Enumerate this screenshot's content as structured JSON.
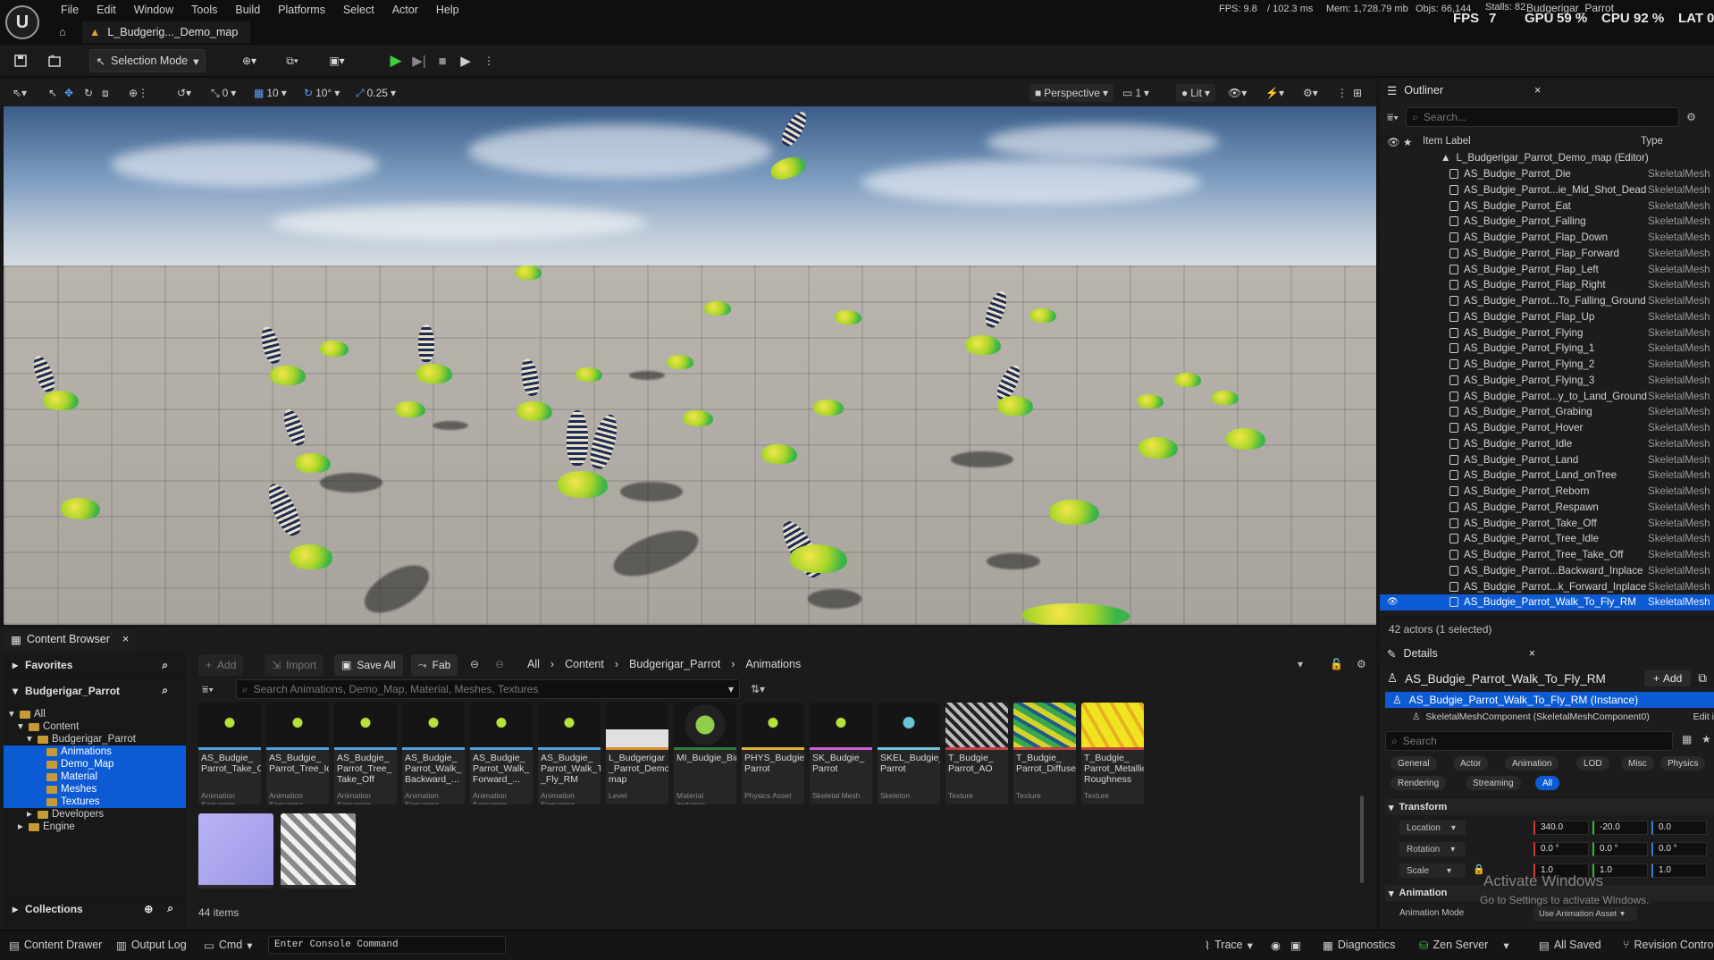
{
  "menu": [
    "File",
    "Edit",
    "Window",
    "Tools",
    "Build",
    "Platforms",
    "Select",
    "Actor",
    "Help"
  ],
  "doc_tab": "L_Budgerig..._Demo_map",
  "stats": {
    "fps_line": "FPS: 9.8",
    "ms": "/ 102.3 ms",
    "mem": "Mem: 1,728.79 mb",
    "objs": "Objs: 66,144",
    "stalls": "Stalls: 82",
    "project": "Budgerigar_Parrot",
    "fps_label": "FPS",
    "fps_value": "7",
    "gpu_label": "GPU",
    "gpu_value": "59 %",
    "cpu_label": "CPU",
    "cpu_value": "92 %",
    "lat_label": "LAT",
    "lat_value": "0"
  },
  "toolbar": {
    "selection_mode": "Selection Mode"
  },
  "viewport_toolbar": {
    "snap_angle": "0",
    "grid_size": "10",
    "rot_snap": "10°",
    "scale_snap": "0.25",
    "view_mode": "Perspective",
    "camera_speed": "1",
    "lighting": "Lit"
  },
  "outliner": {
    "title": "Outliner",
    "search_placeholder": "Search...",
    "col_label": "Item Label",
    "col_type": "Type",
    "root": "L_Budgerigar_Parrot_Demo_map (Editor)",
    "items": [
      {
        "label": "AS_Budgie_Parrot_Die",
        "type": "SkeletalMesh"
      },
      {
        "label": "AS_Budgie_Parrot...ie_Mid_Shot_Dead",
        "type": "SkeletalMesh"
      },
      {
        "label": "AS_Budgie_Parrot_Eat",
        "type": "SkeletalMesh"
      },
      {
        "label": "AS_Budgie_Parrot_Falling",
        "type": "SkeletalMesh"
      },
      {
        "label": "AS_Budgie_Parrot_Flap_Down",
        "type": "SkeletalMesh"
      },
      {
        "label": "AS_Budgie_Parrot_Flap_Forward",
        "type": "SkeletalMesh"
      },
      {
        "label": "AS_Budgie_Parrot_Flap_Left",
        "type": "SkeletalMesh"
      },
      {
        "label": "AS_Budgie_Parrot_Flap_Right",
        "type": "SkeletalMesh"
      },
      {
        "label": "AS_Budgie_Parrot...To_Falling_Ground",
        "type": "SkeletalMesh"
      },
      {
        "label": "AS_Budgie_Parrot_Flap_Up",
        "type": "SkeletalMesh"
      },
      {
        "label": "AS_Budgie_Parrot_Flying",
        "type": "SkeletalMesh"
      },
      {
        "label": "AS_Budgie_Parrot_Flying_1",
        "type": "SkeletalMesh"
      },
      {
        "label": "AS_Budgie_Parrot_Flying_2",
        "type": "SkeletalMesh"
      },
      {
        "label": "AS_Budgie_Parrot_Flying_3",
        "type": "SkeletalMesh"
      },
      {
        "label": "AS_Budgie_Parrot...y_to_Land_Ground",
        "type": "SkeletalMesh"
      },
      {
        "label": "AS_Budgie_Parrot_Grabing",
        "type": "SkeletalMesh"
      },
      {
        "label": "AS_Budgie_Parrot_Hover",
        "type": "SkeletalMesh"
      },
      {
        "label": "AS_Budgie_Parrot_Idle",
        "type": "SkeletalMesh"
      },
      {
        "label": "AS_Budgie_Parrot_Land",
        "type": "SkeletalMesh"
      },
      {
        "label": "AS_Budgie_Parrot_Land_onTree",
        "type": "SkeletalMesh"
      },
      {
        "label": "AS_Budgie_Parrot_Reborn",
        "type": "SkeletalMesh"
      },
      {
        "label": "AS_Budgie_Parrot_Respawn",
        "type": "SkeletalMesh"
      },
      {
        "label": "AS_Budgie_Parrot_Take_Off",
        "type": "SkeletalMesh"
      },
      {
        "label": "AS_Budgie_Parrot_Tree_Idle",
        "type": "SkeletalMesh"
      },
      {
        "label": "AS_Budgie_Parrot_Tree_Take_Off",
        "type": "SkeletalMesh"
      },
      {
        "label": "AS_Budgie_Parrot...Backward_Inplace",
        "type": "SkeletalMesh"
      },
      {
        "label": "AS_Budgie_Parrot...k_Forward_Inplace",
        "type": "SkeletalMesh"
      },
      {
        "label": "AS_Budgie_Parrot_Walk_To_Fly_RM",
        "type": "SkeletalMesh"
      }
    ],
    "footer": "42 actors (1 selected)"
  },
  "content_browser": {
    "tab": "Content Browser",
    "favorites": "Favorites",
    "project": "Budgerigar_Parrot",
    "collections": "Collections",
    "tree": [
      {
        "label": "All",
        "indent": 0,
        "hl": false
      },
      {
        "label": "Content",
        "indent": 1,
        "hl": false
      },
      {
        "label": "Budgerigar_Parrot",
        "indent": 2,
        "hl": false
      },
      {
        "label": "Animations",
        "indent": 3,
        "hl": true
      },
      {
        "label": "Demo_Map",
        "indent": 3,
        "hl": true
      },
      {
        "label": "Material",
        "indent": 3,
        "hl": true
      },
      {
        "label": "Meshes",
        "indent": 3,
        "hl": true
      },
      {
        "label": "Textures",
        "indent": 3,
        "hl": true
      },
      {
        "label": "Developers",
        "indent": 2,
        "hl": false
      },
      {
        "label": "Engine",
        "indent": 1,
        "hl": false
      }
    ],
    "add": "Add",
    "import": "Import",
    "save_all": "Save All",
    "fab": "Fab",
    "breadcrumb": [
      "All",
      "Content",
      "Budgerigar_Parrot",
      "Animations"
    ],
    "search_placeholder": "Search Animations, Demo_Map, Material, Meshes, Textures",
    "assets": [
      {
        "name": "AS_Budgie_ Parrot_Take_Off",
        "kind": "Animation Sequence",
        "color": "#4aa3e0"
      },
      {
        "name": "AS_Budgie_ Parrot_Tree_Idle",
        "kind": "Animation Sequence",
        "color": "#4aa3e0"
      },
      {
        "name": "AS_Budgie_ Parrot_Tree_ Take_Off",
        "kind": "Animation Sequence",
        "color": "#4aa3e0"
      },
      {
        "name": "AS_Budgie_ Parrot_Walk_ Backward_...",
        "kind": "Animation Sequence",
        "color": "#4aa3e0"
      },
      {
        "name": "AS_Budgie_ Parrot_Walk_ Forward_...",
        "kind": "Animation Sequence",
        "color": "#4aa3e0"
      },
      {
        "name": "AS_Budgie_ Parrot_Walk_To _Fly_RM",
        "kind": "Animation Sequence",
        "color": "#4aa3e0"
      },
      {
        "name": "L_Budgerigar _Parrot_Demo_ map",
        "kind": "Level",
        "color": "#e08a2a"
      },
      {
        "name": "MI_Budgie_Bird",
        "kind": "Material Instance",
        "color": "#2f7d3a"
      },
      {
        "name": "PHYS_Budgie_ Parrot",
        "kind": "Physics Asset",
        "color": "#e0b23a"
      },
      {
        "name": "SK_Budgie_ Parrot",
        "kind": "Skeletal Mesh",
        "color": "#d35ad6"
      },
      {
        "name": "SKEL_Budgie_ Parrot",
        "kind": "Skeleton",
        "color": "#6ac5d8"
      },
      {
        "name": "T_Budgie_ Parrot_AO",
        "kind": "Texture",
        "color": "#c84040"
      },
      {
        "name": "T_Budgie_ Parrot_Diffuse",
        "kind": "Texture",
        "color": "#c84040"
      },
      {
        "name": "T_Budgie_ Parrot_Metallic_ Roughness",
        "kind": "Texture",
        "color": "#c84040"
      }
    ],
    "item_count": "44 items"
  },
  "details": {
    "title": "Details",
    "actor": "AS_Budgie_Parrot_Walk_To_Fly_RM",
    "add": "Add",
    "instance": "AS_Budgie_Parrot_Walk_To_Fly_RM (Instance)",
    "component": "SkeletalMeshComponent (SkeletalMeshComponent0)",
    "edit": "Edit i",
    "search_placeholder": "Search",
    "filters": [
      "General",
      "Actor",
      "Animation",
      "LOD",
      "Misc",
      "Physics"
    ],
    "filters2": [
      "Rendering",
      "Streaming",
      "All"
    ],
    "transform": "Transform",
    "location": {
      "label": "Location",
      "x": "340.0",
      "y": "-20.0",
      "z": "0.0"
    },
    "rotation": {
      "label": "Rotation",
      "x": "0.0 °",
      "y": "0.0 °",
      "z": "0.0 °"
    },
    "scale": {
      "label": "Scale",
      "x": "1.0",
      "y": "1.0",
      "z": "1.0"
    },
    "animation": "Animation",
    "anim_mode_label": "Animation Mode",
    "anim_mode_value": "Use Animation Asset"
  },
  "statusbar": {
    "content_drawer": "Content Drawer",
    "output_log": "Output Log",
    "cmd": "Cmd",
    "console_placeholder": "Enter Console Command",
    "trace": "Trace",
    "diagnostics": "Diagnostics",
    "zen": "Zen Server",
    "saved": "All Saved",
    "revision": "Revision Contro"
  },
  "watermark": {
    "title": "Activate Windows",
    "sub": "Go to Settings to activate Windows."
  },
  "accent": "#0c5bd4"
}
